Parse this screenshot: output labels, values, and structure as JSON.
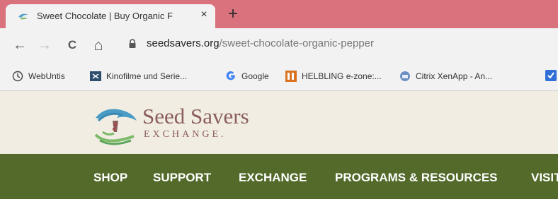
{
  "browser": {
    "tab": {
      "title": "Sweet Chocolate | Buy Organic F",
      "close": "×"
    },
    "new_tab": "+",
    "nav": {
      "back": "←",
      "forward": "→",
      "reload": "C",
      "home": "⌂"
    },
    "url": {
      "host": "seedsavers.org",
      "path": "/sweet-chocolate-organic-pepper"
    },
    "bookmarks": [
      {
        "label": "WebUntis",
        "icon": "clock-icon"
      },
      {
        "label": "Kinofilme und Serie...",
        "icon": "film-icon"
      },
      {
        "label": "Google",
        "icon": "google-icon"
      },
      {
        "label": "HELBLING e-zone:...",
        "icon": "helbling-icon"
      },
      {
        "label": "Citrix XenApp - An...",
        "icon": "citrix-icon"
      }
    ]
  },
  "site": {
    "logo": {
      "title": "Seed Savers",
      "subtitle": "EXCHANGE."
    },
    "nav": [
      "SHOP",
      "SUPPORT",
      "EXCHANGE",
      "PROGRAMS & RESOURCES",
      "VISIT"
    ]
  },
  "colors": {
    "tab_strip": "#d9727d",
    "nav_bar": "#536a2a",
    "site_bg": "#f1ede3",
    "logo_text": "#8b5d5d"
  }
}
